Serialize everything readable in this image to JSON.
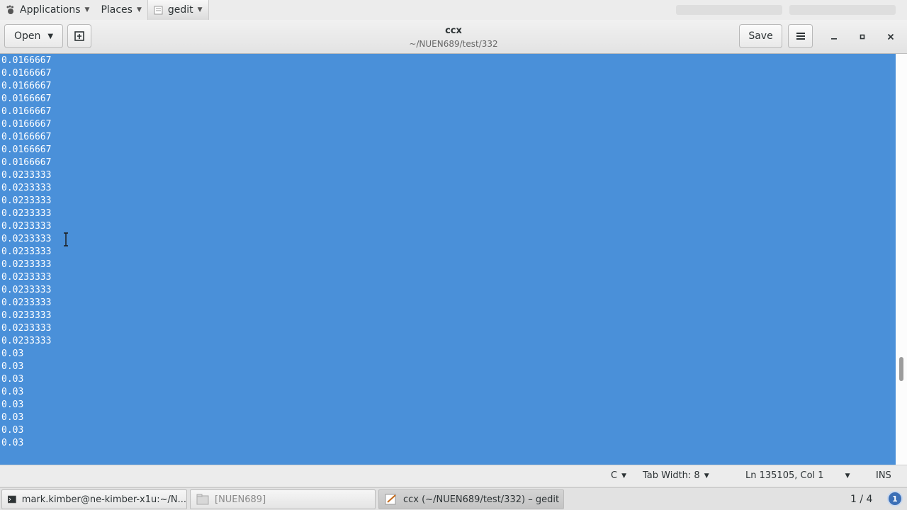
{
  "top_panel": {
    "applications_label": "Applications",
    "places_label": "Places",
    "app_label": "gedit"
  },
  "header": {
    "open_label": "Open",
    "title": "ccx",
    "subtitle": "~/NUEN689/test/332",
    "save_label": "Save"
  },
  "editor": {
    "lines": [
      "0.0166667",
      "0.0166667",
      "0.0166667",
      "0.0166667",
      "0.0166667",
      "0.0166667",
      "0.0166667",
      "0.0166667",
      "0.0166667",
      "0.0233333",
      "0.0233333",
      "0.0233333",
      "0.0233333",
      "0.0233333",
      "0.0233333",
      "0.0233333",
      "0.0233333",
      "0.0233333",
      "0.0233333",
      "0.0233333",
      "0.0233333",
      "0.0233333",
      "0.0233333",
      "0.03",
      "0.03",
      "0.03",
      "0.03",
      "0.03",
      "0.03",
      "0.03",
      "0.03"
    ],
    "selection_color": "#4a90d9"
  },
  "status_bar": {
    "language": "C",
    "tab_width": "Tab Width: 8",
    "position": "Ln 135105, Col 1",
    "mode": "INS"
  },
  "taskbar": {
    "items": [
      {
        "label": "mark.kimber@ne-kimber-x1u:~/N..."
      },
      {
        "label": "[NUEN689]"
      },
      {
        "label": "ccx (~/NUEN689/test/332) – gedit"
      }
    ],
    "workspace": "1 / 4",
    "notification": "1"
  }
}
